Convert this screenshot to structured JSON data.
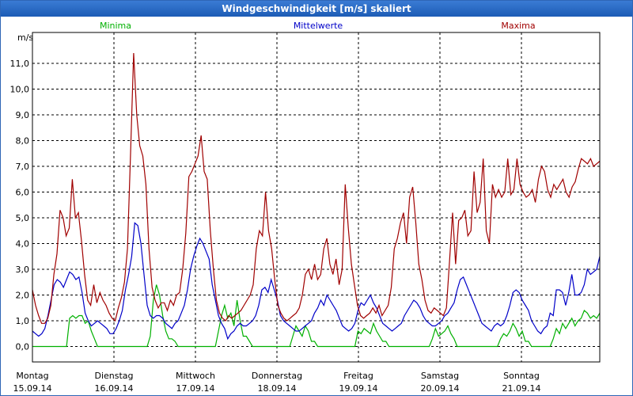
{
  "window": {
    "title": "Windgeschwindigkeit [m/s] skaliert"
  },
  "chart_data": {
    "type": "line",
    "title": "Windgeschwindigkeit [m/s] skaliert",
    "ylabel": "m/s",
    "ylim": [
      -0.6,
      12.2
    ],
    "yticks": [
      "0,0",
      "1,0",
      "2,0",
      "3,0",
      "4,0",
      "5,0",
      "6,0",
      "7,0",
      "8,0",
      "9,0",
      "10,0",
      "11,0"
    ],
    "days": [
      {
        "name": "Montag",
        "date": "15.09.14"
      },
      {
        "name": "Dienstag",
        "date": "16.09.14"
      },
      {
        "name": "Mittwoch",
        "date": "17.09.14"
      },
      {
        "name": "Donnerstag",
        "date": "18.09.14"
      },
      {
        "name": "Freitag",
        "date": "19.09.14"
      },
      {
        "name": "Samstag",
        "date": "20.09.14"
      },
      {
        "name": "Sonntag",
        "date": "21.09.14"
      }
    ],
    "grid": true,
    "series": [
      {
        "name": "Minima",
        "color": "#00b000",
        "values": [
          0,
          0,
          0,
          0,
          0,
          0,
          0,
          0,
          0,
          0,
          0,
          0,
          1.1,
          1.2,
          1.1,
          1.2,
          1.2,
          0.9,
          1.0,
          0.6,
          0.3,
          0,
          0,
          0,
          0,
          0,
          0,
          0,
          0,
          0,
          0,
          0,
          0,
          0,
          0,
          0,
          0,
          0,
          0.4,
          1.8,
          2.4,
          2.0,
          1.2,
          0.6,
          0.3,
          0.3,
          0.2,
          0,
          0,
          0,
          0,
          0,
          0,
          0,
          0,
          0,
          0,
          0,
          0,
          0,
          0.6,
          1.2,
          1.6,
          1.1,
          1.3,
          0.8,
          1.8,
          1.0,
          0.4,
          0.4,
          0.2,
          0,
          0,
          0,
          0,
          0,
          0,
          0,
          0,
          0,
          0,
          0,
          0,
          0,
          0.4,
          0.8,
          0.6,
          0.4,
          0.8,
          0.6,
          0.2,
          0.2,
          0,
          0,
          0,
          0,
          0,
          0,
          0,
          0,
          0,
          0,
          0,
          0,
          0,
          0.6,
          0.5,
          0.7,
          0.6,
          0.5,
          0.9,
          0.6,
          0.4,
          0.2,
          0.2,
          0,
          0,
          0,
          0,
          0,
          0,
          0,
          0,
          0,
          0,
          0,
          0,
          0,
          0,
          0.3,
          0.7,
          0.4,
          0.5,
          0.6,
          0.8,
          0.5,
          0.3,
          0,
          0,
          0,
          0,
          0,
          0,
          0,
          0,
          0,
          0,
          0,
          0,
          0,
          0,
          0.3,
          0.5,
          0.4,
          0.6,
          0.9,
          0.7,
          0.4,
          0.6,
          0.2,
          0.2,
          0,
          0,
          0,
          0,
          0,
          0,
          0,
          0.3,
          0.7,
          0.5,
          0.9,
          0.7,
          0.9,
          1.1,
          0.8,
          1.0,
          1.1,
          1.4,
          1.3,
          1.1,
          1.2,
          1.1,
          1.3
        ]
      },
      {
        "name": "Mittelwerte",
        "color": "#0000c8",
        "values": [
          0.6,
          0.5,
          0.4,
          0.5,
          0.7,
          1.2,
          1.8,
          2.4,
          2.6,
          2.5,
          2.3,
          2.6,
          2.9,
          2.8,
          2.6,
          2.7,
          2.1,
          1.3,
          1.0,
          0.8,
          0.9,
          1.0,
          0.9,
          0.8,
          0.7,
          0.5,
          0.5,
          0.7,
          1.0,
          1.4,
          2.2,
          2.8,
          3.5,
          4.8,
          4.7,
          4.0,
          2.8,
          1.6,
          1.2,
          1.1,
          1.2,
          1.2,
          1.1,
          0.9,
          0.8,
          0.7,
          0.9,
          1.0,
          1.3,
          1.6,
          2.2,
          3.0,
          3.5,
          3.9,
          4.2,
          4.0,
          3.7,
          3.4,
          2.4,
          1.8,
          1.2,
          0.9,
          0.7,
          0.3,
          0.5,
          0.6,
          0.8,
          0.9,
          0.8,
          0.8,
          0.9,
          1.0,
          1.2,
          1.6,
          2.2,
          2.3,
          2.1,
          2.6,
          2.2,
          1.8,
          1.2,
          1.0,
          0.9,
          0.8,
          0.7,
          0.6,
          0.6,
          0.7,
          0.8,
          0.9,
          1.0,
          1.3,
          1.5,
          1.8,
          1.6,
          2.0,
          1.8,
          1.6,
          1.4,
          1.1,
          0.8,
          0.7,
          0.6,
          0.7,
          0.9,
          1.4,
          1.7,
          1.6,
          1.8,
          2.0,
          1.7,
          1.5,
          1.2,
          0.9,
          0.8,
          0.7,
          0.6,
          0.7,
          0.8,
          0.9,
          1.2,
          1.4,
          1.6,
          1.8,
          1.7,
          1.5,
          1.2,
          1.0,
          0.9,
          0.8,
          0.8,
          0.9,
          1.0,
          1.2,
          1.3,
          1.5,
          1.7,
          2.2,
          2.6,
          2.7,
          2.4,
          2.1,
          1.8,
          1.5,
          1.2,
          0.9,
          0.8,
          0.7,
          0.6,
          0.8,
          0.9,
          0.8,
          0.9,
          1.2,
          1.6,
          2.1,
          2.2,
          2.1,
          1.8,
          1.6,
          1.4,
          1.0,
          0.8,
          0.6,
          0.5,
          0.7,
          0.8,
          1.3,
          1.2,
          2.2,
          2.2,
          2.1,
          1.6,
          2.1,
          2.8,
          2.0,
          2.0,
          2.1,
          2.4,
          3.0,
          2.8,
          2.9,
          3.0,
          3.5
        ]
      },
      {
        "name": "Maxima",
        "color": "#a00000",
        "values": [
          2.2,
          1.6,
          1.2,
          0.9,
          0.9,
          1.1,
          1.6,
          2.8,
          3.6,
          5.3,
          5.0,
          4.3,
          4.6,
          6.5,
          5.0,
          5.2,
          4.1,
          2.8,
          1.8,
          1.6,
          2.4,
          1.7,
          2.1,
          1.8,
          1.6,
          1.3,
          1.1,
          1.0,
          1.5,
          1.9,
          2.5,
          3.8,
          7.5,
          11.4,
          9.0,
          7.8,
          7.4,
          6.3,
          3.8,
          2.3,
          1.8,
          1.5,
          1.7,
          1.7,
          1.4,
          1.8,
          1.6,
          2.0,
          2.1,
          3.0,
          4.4,
          6.6,
          6.8,
          7.1,
          7.4,
          8.2,
          6.8,
          6.5,
          4.5,
          3.0,
          1.8,
          1.3,
          1.1,
          1.0,
          1.2,
          1.1,
          1.2,
          1.3,
          1.4,
          1.6,
          1.8,
          2.0,
          2.4,
          3.8,
          4.5,
          4.3,
          6.0,
          4.5,
          3.8,
          2.6,
          1.6,
          1.3,
          1.1,
          1.0,
          1.1,
          1.2,
          1.3,
          1.5,
          2.0,
          2.8,
          3.0,
          2.6,
          3.2,
          2.6,
          2.8,
          3.8,
          4.2,
          3.2,
          2.8,
          3.4,
          2.4,
          3.0,
          6.3,
          4.6,
          3.2,
          2.4,
          1.6,
          1.2,
          1.1,
          1.2,
          1.3,
          1.5,
          1.3,
          1.6,
          1.2,
          1.4,
          1.6,
          2.3,
          3.8,
          4.2,
          4.8,
          5.2,
          4.0,
          5.8,
          6.2,
          4.8,
          3.2,
          2.6,
          1.8,
          1.4,
          1.3,
          1.5,
          1.4,
          1.3,
          1.2,
          1.5,
          3.3,
          5.2,
          3.2,
          4.9,
          5.0,
          5.3,
          4.3,
          4.5,
          6.8,
          5.2,
          5.6,
          7.3,
          4.5,
          4.0,
          6.3,
          5.8,
          6.1,
          5.8,
          6.0,
          7.3,
          5.9,
          6.1,
          7.3,
          6.3,
          6.0,
          5.8,
          5.9,
          6.1,
          5.6,
          6.5,
          7.0,
          6.8,
          6.1,
          5.8,
          6.3,
          6.1,
          6.3,
          6.5,
          6.0,
          5.8,
          6.2,
          6.4,
          6.9,
          7.3,
          7.2,
          7.1,
          7.3,
          7.0,
          7.1,
          7.2
        ]
      }
    ]
  }
}
